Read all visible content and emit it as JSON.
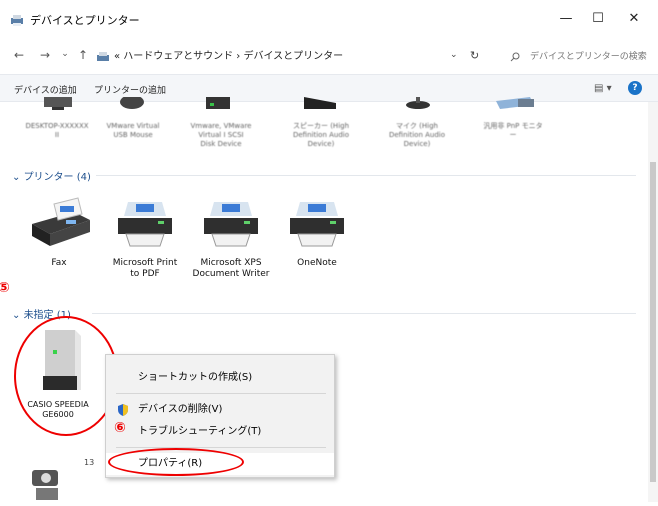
{
  "window": {
    "title": "デバイスとプリンター",
    "minimize": "—",
    "maximize": "☐",
    "close": "✕"
  },
  "nav": {
    "back": "←",
    "forward": "→",
    "recent": "⌄",
    "up": "↑",
    "breadcrumb": "« ハードウェアとサウンド › デバイスとプリンター",
    "dropdown": "⌄",
    "refresh": "↻",
    "search_placeholder": "デバイスとプリンターの検索"
  },
  "commands": {
    "add_device": "デバイスの追加",
    "add_printer": "プリンターの追加",
    "view": "▤ ▾",
    "help": "?"
  },
  "top_devices": [
    {
      "label": "DESKTOP-XXXXXX\nII"
    },
    {
      "label": "VMware Virtual\nUSB Mouse"
    },
    {
      "label": "Vmware, VMware\nVirtual I SCSI\nDisk Device"
    },
    {
      "label": "スピーカー (High\nDefinition Audio\nDevice)"
    },
    {
      "label": "マイク (High\nDefinition Audio\nDevice)"
    },
    {
      "label": "汎用非 PnP モニタ\nー"
    }
  ],
  "groups": {
    "printers": "プリンター (4)",
    "unspecified": "未指定 (1)"
  },
  "printers": [
    {
      "label": "Fax"
    },
    {
      "label": "Microsoft Print\nto PDF"
    },
    {
      "label": "Microsoft XPS\nDocument Writer"
    },
    {
      "label": "OneNote"
    }
  ],
  "unspecified_device": {
    "label": "CASIO SPEEDIA\nGE6000"
  },
  "bottom_device": {
    "count": "13"
  },
  "callouts": {
    "five": "⑤",
    "six": "⑥"
  },
  "context_menu": {
    "shortcut": "ショートカットの作成(S)",
    "remove": "デバイスの削除(V)",
    "troubleshoot": "トラブルシューティング(T)",
    "properties": "プロパティ(R)"
  },
  "colors": {
    "accent": "#1a73c8",
    "callout": "#e00000",
    "group": "#1c4e8c"
  }
}
